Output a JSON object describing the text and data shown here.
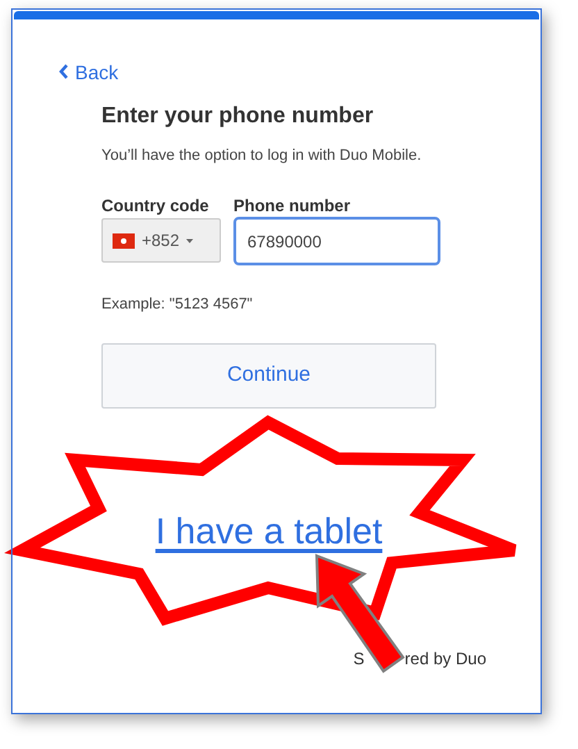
{
  "back_link": {
    "label": "Back"
  },
  "title": "Enter your phone number",
  "subtitle": "You’ll have the option to log in with Duo Mobile.",
  "country_code": {
    "label": "Country code",
    "value": "+852"
  },
  "phone_number": {
    "label": "Phone number",
    "value": "67890000",
    "focused": true
  },
  "example": "Example: \"5123 4567\"",
  "continue_button": "Continue",
  "tablet_link": "I have a tablet",
  "footer": [
    "S",
    "red by Duo"
  ]
}
